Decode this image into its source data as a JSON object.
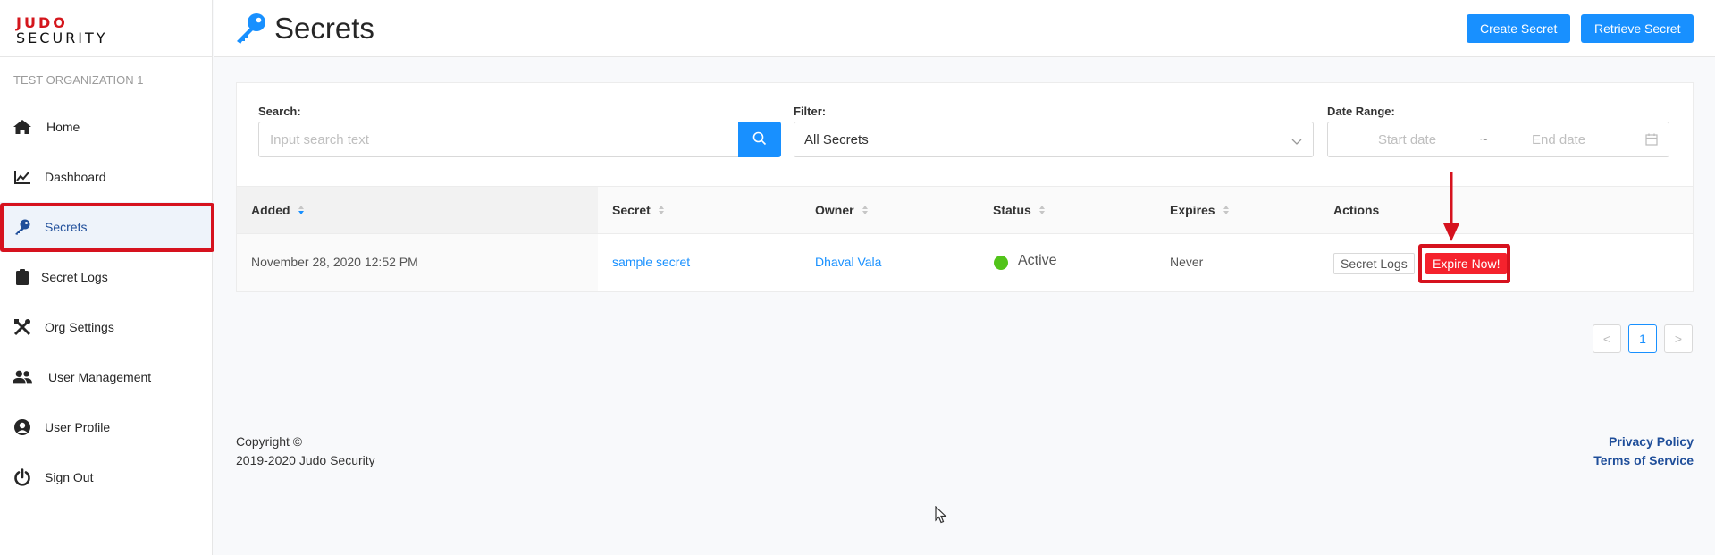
{
  "brand": {
    "line1": "JUDO",
    "line2": "SECURITY"
  },
  "org_name": "TEST ORGANIZATION 1",
  "sidebar": {
    "items": [
      {
        "label": "Home",
        "icon": "home-icon"
      },
      {
        "label": "Dashboard",
        "icon": "chart-line-icon"
      },
      {
        "label": "Secrets",
        "icon": "key-icon",
        "active": true
      },
      {
        "label": "Secret Logs",
        "icon": "clipboard-icon"
      },
      {
        "label": "Org Settings",
        "icon": "tools-icon"
      },
      {
        "label": "User Management",
        "icon": "users-icon"
      },
      {
        "label": "User Profile",
        "icon": "user-circle-icon"
      },
      {
        "label": "Sign Out",
        "icon": "power-icon"
      }
    ]
  },
  "header": {
    "title": "Secrets",
    "create_label": "Create Secret",
    "retrieve_label": "Retrieve Secret"
  },
  "filters": {
    "search_label": "Search:",
    "search_placeholder": "Input search text",
    "filter_label": "Filter:",
    "filter_value": "All Secrets",
    "date_label": "Date Range:",
    "start_placeholder": "Start date",
    "separator": "~",
    "end_placeholder": "End date"
  },
  "table": {
    "columns": [
      "Added",
      "Secret",
      "Owner",
      "Status",
      "Expires",
      "Actions"
    ],
    "rows": [
      {
        "added": "November 28, 2020 12:52 PM",
        "secret": "sample secret",
        "owner": "Dhaval Vala",
        "status": "Active",
        "expires": "Never",
        "action_logs": "Secret Logs",
        "action_expire": "Expire Now!"
      }
    ]
  },
  "pagination": {
    "prev": "<",
    "current": "1",
    "next": ">"
  },
  "footer": {
    "copyright": "Copyright ©",
    "years": "2019-2020 Judo Security",
    "privacy": "Privacy Policy",
    "terms": "Terms of Service"
  },
  "colors": {
    "primary": "#1890ff",
    "brand_red": "#d4161c",
    "danger": "#f5222d",
    "active_status": "#52c41a",
    "annotation": "#d6121e"
  }
}
